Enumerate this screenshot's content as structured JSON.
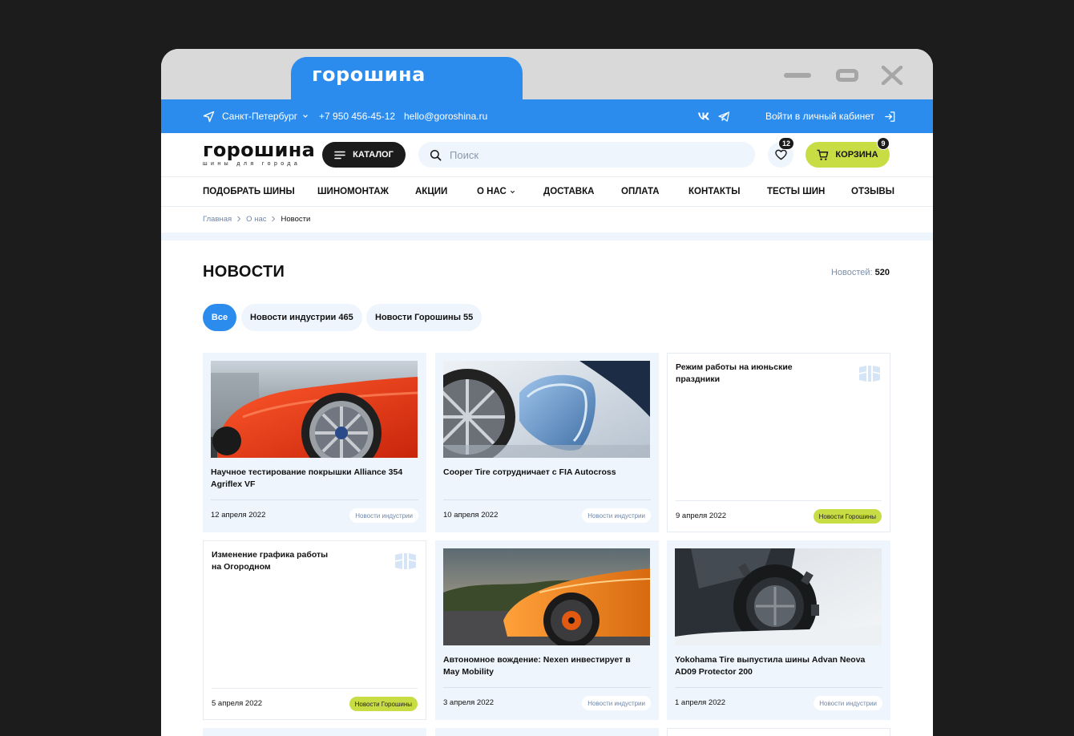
{
  "brand": {
    "name": "горошина",
    "logo_text": "горошина",
    "tagline": "шины для города",
    "colors": {
      "primary": "#2c8cee",
      "accent": "#c8dd44",
      "light": "#eef5fd",
      "dark": "#1b1b1b"
    }
  },
  "window_controls": {
    "minimize_icon": "minimize-icon",
    "maximize_icon": "maximize-icon",
    "close_icon": "close-icon"
  },
  "topbar": {
    "city": "Санкт-Петербург",
    "phone": "+7 950 456-45-12",
    "email": "hello@goroshina.ru",
    "social": [
      "vk-icon",
      "telegram-icon"
    ],
    "login": "Войти в личный кабинет"
  },
  "header": {
    "catalog": "КАТАЛОГ",
    "search_placeholder": "Поиск",
    "favorites_count": "12",
    "cart_label": "КОРЗИНА",
    "cart_count": "9"
  },
  "nav": [
    {
      "label": "ПОДОБРАТЬ ШИНЫ"
    },
    {
      "label": "ШИНОМОНТАЖ"
    },
    {
      "label": "АКЦИИ"
    },
    {
      "label": "О НАС"
    },
    {
      "label": "ДОСТАВКА"
    },
    {
      "label": "ОПЛАТА"
    },
    {
      "label": "КОНТАКТЫ"
    },
    {
      "label": "ТЕСТЫ ШИН"
    },
    {
      "label": "ОТЗЫВЫ"
    }
  ],
  "breadcrumb": [
    "Главная",
    "О нас",
    "Новости"
  ],
  "page": {
    "title": "НОВОСТИ",
    "count_label": "Новостей:",
    "count": "520"
  },
  "filters": [
    {
      "label": "Все",
      "active": true
    },
    {
      "label": "Новости индустрии 465",
      "active": false
    },
    {
      "label": "Новости Горошины 55",
      "active": false
    }
  ],
  "news": [
    {
      "title": "Научное тестирование покрышки Alliance 354 Agriflex VF",
      "date": "12 апреля 2022",
      "tag": "Новости индустрии",
      "image": "orange-bmw-photo"
    },
    {
      "title": "Cooper Tire сотрудничает с FIA Autocross",
      "date": "10 апреля 2022",
      "tag": "Новости индустрии",
      "image": "white-car-mirror-photo"
    },
    {
      "title": "Режим работы на июньские праздники",
      "date": "9 апреля 2022",
      "tag": "Новости Горошины",
      "image": ""
    },
    {
      "title": "Изменение графика работы на Огородном",
      "date": "5 апреля 2022",
      "tag": "Новости Горошины",
      "image": ""
    },
    {
      "title": "Автономное вождение: Nexen инвестирует в May Mobility",
      "date": "3 апреля 2022",
      "tag": "Новости индустрии",
      "image": "orange-lamborghini-photo"
    },
    {
      "title": "Yokohama Tire выпустила шины Advan Neova AD09 Protector 200",
      "date": "1 апреля 2022",
      "tag": "Новости индустрии",
      "image": "offroad-tire-snow-photo"
    }
  ]
}
